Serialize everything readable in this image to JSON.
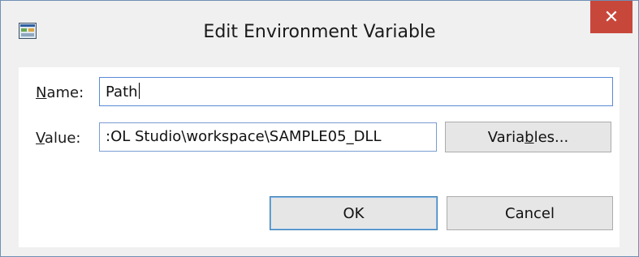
{
  "window": {
    "title": "Edit Environment Variable",
    "app_icon": "environment-variables-icon",
    "close_glyph": "✕"
  },
  "form": {
    "name_label_mnemonic": "N",
    "name_label_rest": "ame:",
    "name_value": "Path",
    "value_label_mnemonic": "V",
    "value_label_rest": "alue:",
    "value_value": ":OL Studio\\workspace\\SAMPLE05_DLL"
  },
  "buttons": {
    "variables_pre": "Varia",
    "variables_mnemonic": "b",
    "variables_post": "les...",
    "ok": "OK",
    "cancel": "Cancel"
  },
  "colors": {
    "close_button": "#c8473b",
    "focus_border": "#5a8ad6",
    "default_button_border": "#3c7fb1"
  }
}
